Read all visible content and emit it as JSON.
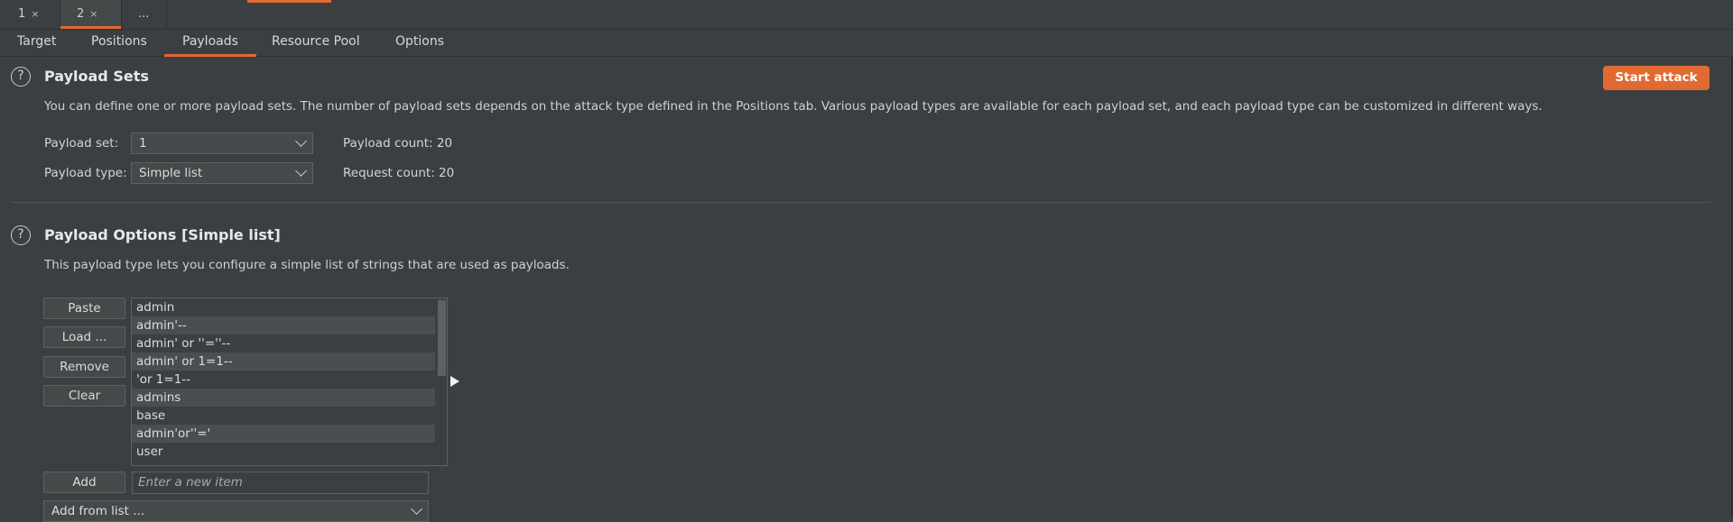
{
  "request_tabs": [
    {
      "label": "1",
      "close": "×"
    },
    {
      "label": "2",
      "close": "×"
    },
    {
      "label": "..."
    }
  ],
  "sub_tabs": [
    "Target",
    "Positions",
    "Payloads",
    "Resource Pool",
    "Options"
  ],
  "active_sub_tab": "Payloads",
  "payload_sets": {
    "help": "?",
    "title": "Payload Sets",
    "description": "You can define one or more payload sets. The number of payload sets depends on the attack type defined in the Positions tab. Various payload types are available for each payload set, and each payload type can be customized in different ways.",
    "start_attack": "Start attack",
    "payload_set_label": "Payload set:",
    "payload_set_value": "1",
    "payload_type_label": "Payload type:",
    "payload_type_value": "Simple list",
    "payload_count": "Payload count: 20",
    "request_count": "Request count: 20"
  },
  "payload_options": {
    "help": "?",
    "title": "Payload Options [Simple list]",
    "description": "This payload type lets you configure a simple list of strings that are used as payloads.",
    "buttons": {
      "paste": "Paste",
      "load": "Load ...",
      "remove": "Remove",
      "clear": "Clear",
      "add": "Add"
    },
    "items": [
      "admin",
      "admin'--",
      "admin' or ''=''--",
      "admin' or 1=1--",
      "'or 1=1--",
      "admins",
      "base",
      "admin'or''='",
      "user"
    ],
    "new_item_placeholder": "Enter a new item",
    "add_from_list": "Add from list ..."
  },
  "colors": {
    "accent": "#e06a32",
    "background": "#3c3f41"
  }
}
